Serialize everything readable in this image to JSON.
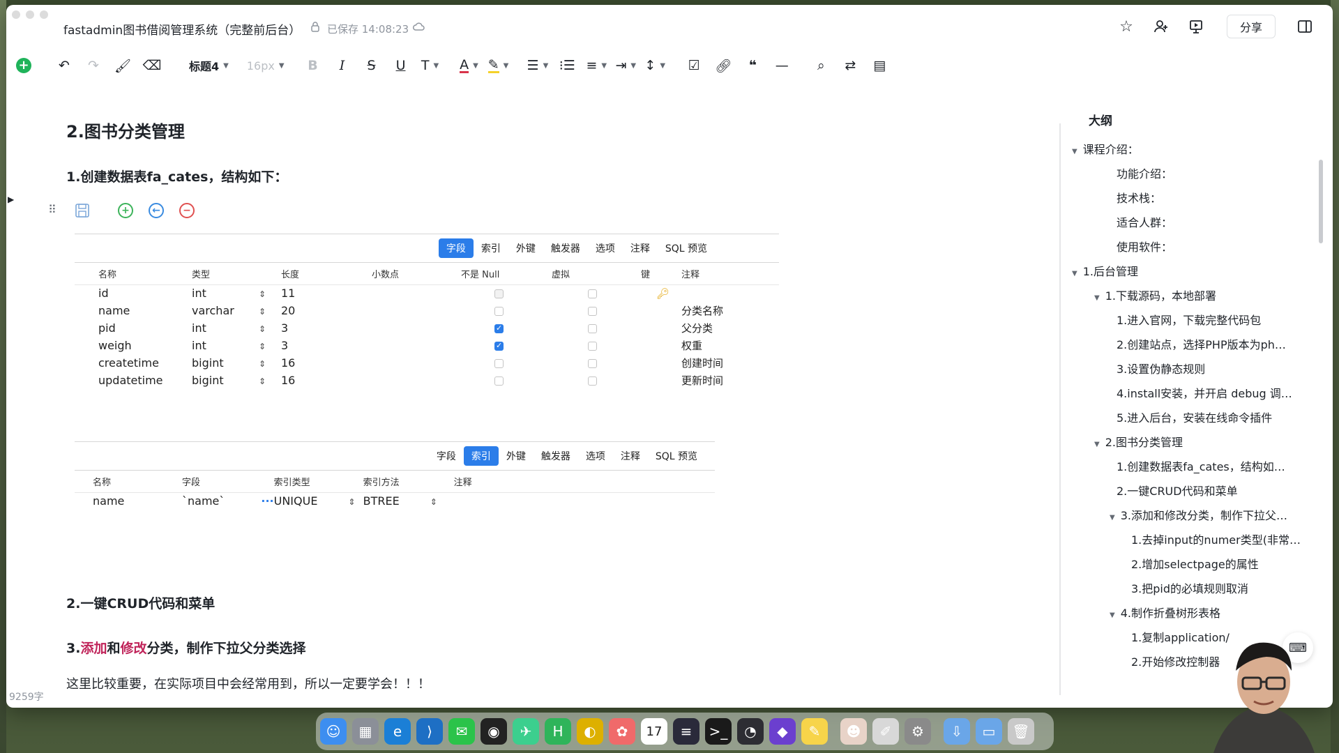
{
  "window": {
    "title": "fastadmin图书借阅管理系统（完整前后台）",
    "saved_status": "已保存 14:08:23",
    "share_label": "分享"
  },
  "toolbar": {
    "heading_style": "标题4",
    "font_size": "16px"
  },
  "document": {
    "section_title": "2.图书分类管理",
    "step1": "1.创建数据表fa_cates，结构如下：",
    "step2": "2.一键CRUD代码和菜单",
    "step3_prefix": "3.",
    "step3_add": "添加",
    "step3_and": "和",
    "step3_modify": "修改",
    "step3_suffix": "分类，制作下拉父分类选择",
    "paragraph": "这里比较重要，在实际项目中会经常用到，所以一定要学会！！！",
    "word_count": "9259字"
  },
  "fields_table": {
    "tabs": [
      "字段",
      "索引",
      "外键",
      "触发器",
      "选项",
      "注释",
      "SQL 预览"
    ],
    "active_tab": 0,
    "headers": [
      "名称",
      "类型",
      "长度",
      "小数点",
      "不是 Null",
      "虚拟",
      "键",
      "注释"
    ],
    "rows": [
      {
        "name": "id",
        "type": "int",
        "length": "11",
        "not_null": "dim",
        "virtual": false,
        "key": true,
        "comment": ""
      },
      {
        "name": "name",
        "type": "varchar",
        "length": "20",
        "not_null": "off",
        "virtual": false,
        "key": false,
        "comment": "分类名称"
      },
      {
        "name": "pid",
        "type": "int",
        "length": "3",
        "not_null": "on",
        "virtual": false,
        "key": false,
        "comment": "父分类"
      },
      {
        "name": "weigh",
        "type": "int",
        "length": "3",
        "not_null": "on",
        "virtual": false,
        "key": false,
        "comment": "权重"
      },
      {
        "name": "createtime",
        "type": "bigint",
        "length": "16",
        "not_null": "off",
        "virtual": false,
        "key": false,
        "comment": "创建时间"
      },
      {
        "name": "updatetime",
        "type": "bigint",
        "length": "16",
        "not_null": "off",
        "virtual": false,
        "key": false,
        "comment": "更新时间"
      }
    ]
  },
  "index_table": {
    "tabs": [
      "字段",
      "索引",
      "外键",
      "触发器",
      "选项",
      "注释",
      "SQL 预览"
    ],
    "active_tab": 1,
    "headers": [
      "名称",
      "字段",
      "索引类型",
      "索引方法",
      "注释"
    ],
    "rows": [
      {
        "name": "name",
        "field": "`name`",
        "type": "UNIQUE",
        "method": "BTREE",
        "comment": ""
      }
    ]
  },
  "outline": {
    "title": "大纲",
    "items": [
      {
        "label": "课程介绍：",
        "level": 0,
        "caret": true
      },
      {
        "label": "功能介绍：",
        "level": 1,
        "caret": false
      },
      {
        "label": "技术栈：",
        "level": 1,
        "caret": false
      },
      {
        "label": "适合人群：",
        "level": 1,
        "caret": false
      },
      {
        "label": "使用软件：",
        "level": 1,
        "caret": false
      },
      {
        "label": "1.后台管理",
        "level": 0,
        "caret": true
      },
      {
        "label": "1.下载源码，本地部署",
        "level": 1,
        "caret": true
      },
      {
        "label": "1.进入官网，下载完整代码包",
        "level": 2,
        "caret": false
      },
      {
        "label": "2.创建站点，选择PHP版本为ph…",
        "level": 2,
        "caret": false
      },
      {
        "label": "3.设置伪静态规则",
        "level": 2,
        "caret": false
      },
      {
        "label": "4.install安装，并开启 debug 调…",
        "level": 2,
        "caret": false
      },
      {
        "label": "5.进入后台，安装在线命令插件",
        "level": 2,
        "caret": false
      },
      {
        "label": "2.图书分类管理",
        "level": 1,
        "caret": true
      },
      {
        "label": "1.创建数据表fa_cates，结构如…",
        "level": 2,
        "caret": false
      },
      {
        "label": "2.一键CRUD代码和菜单",
        "level": 2,
        "caret": false
      },
      {
        "label": "3.添加和修改分类，制作下拉父…",
        "level": 2,
        "caret": true
      },
      {
        "label": "1.去掉input的numer类型(非常…",
        "level": 3,
        "caret": false
      },
      {
        "label": "2.增加selectpage的属性",
        "level": 3,
        "caret": false
      },
      {
        "label": "3.把pid的必填规则取消",
        "level": 3,
        "caret": false
      },
      {
        "label": "4.制作折叠树形表格",
        "level": 2,
        "caret": true
      },
      {
        "label": "1.复制application/",
        "level": 3,
        "caret": false
      },
      {
        "label": "2.开始修改控制器",
        "level": 3,
        "caret": false
      }
    ]
  },
  "dock": {
    "apps": [
      {
        "icon": "finder-icon",
        "color": "#3d8ef0"
      },
      {
        "icon": "launchpad-icon",
        "color": "#8b8f98"
      },
      {
        "icon": "edge-icon",
        "color": "#1b7fd6"
      },
      {
        "icon": "vscode-icon",
        "color": "#1e6fc4"
      },
      {
        "icon": "wechat-icon",
        "color": "#2bc34a"
      },
      {
        "icon": "qq-icon",
        "color": "#222222"
      },
      {
        "icon": "feishu-icon",
        "color": "#3ccf8e"
      },
      {
        "icon": "hbuilder-icon",
        "color": "#2fb45a"
      },
      {
        "icon": "navicat-icon",
        "color": "#ddb000"
      },
      {
        "icon": "photos-icon",
        "color": "#f06a6a"
      },
      {
        "icon": "calendar-icon",
        "color": "#ffffff"
      },
      {
        "icon": "slack-icon",
        "color": "#2a2a3a"
      },
      {
        "icon": "terminal-icon",
        "color": "#1a1a1a"
      },
      {
        "icon": "activity-monitor-icon",
        "color": "#2d2d33"
      },
      {
        "icon": "obsidian-icon",
        "color": "#6b3fcf"
      },
      {
        "icon": "notes-icon",
        "color": "#f7d44a"
      },
      {
        "icon": "avatar-app-icon",
        "color": "#e8d3c8"
      },
      {
        "icon": "script-editor-icon",
        "color": "#d8d8d8"
      },
      {
        "icon": "system-settings-icon",
        "color": "#8a8a8a"
      },
      {
        "icon": "downloads-folder-icon",
        "color": "#6aa6e8"
      },
      {
        "icon": "documents-folder-icon",
        "color": "#6aa6e8"
      },
      {
        "icon": "trash-icon",
        "color": "#c9c9c9"
      }
    ],
    "calendar_day": "17"
  }
}
